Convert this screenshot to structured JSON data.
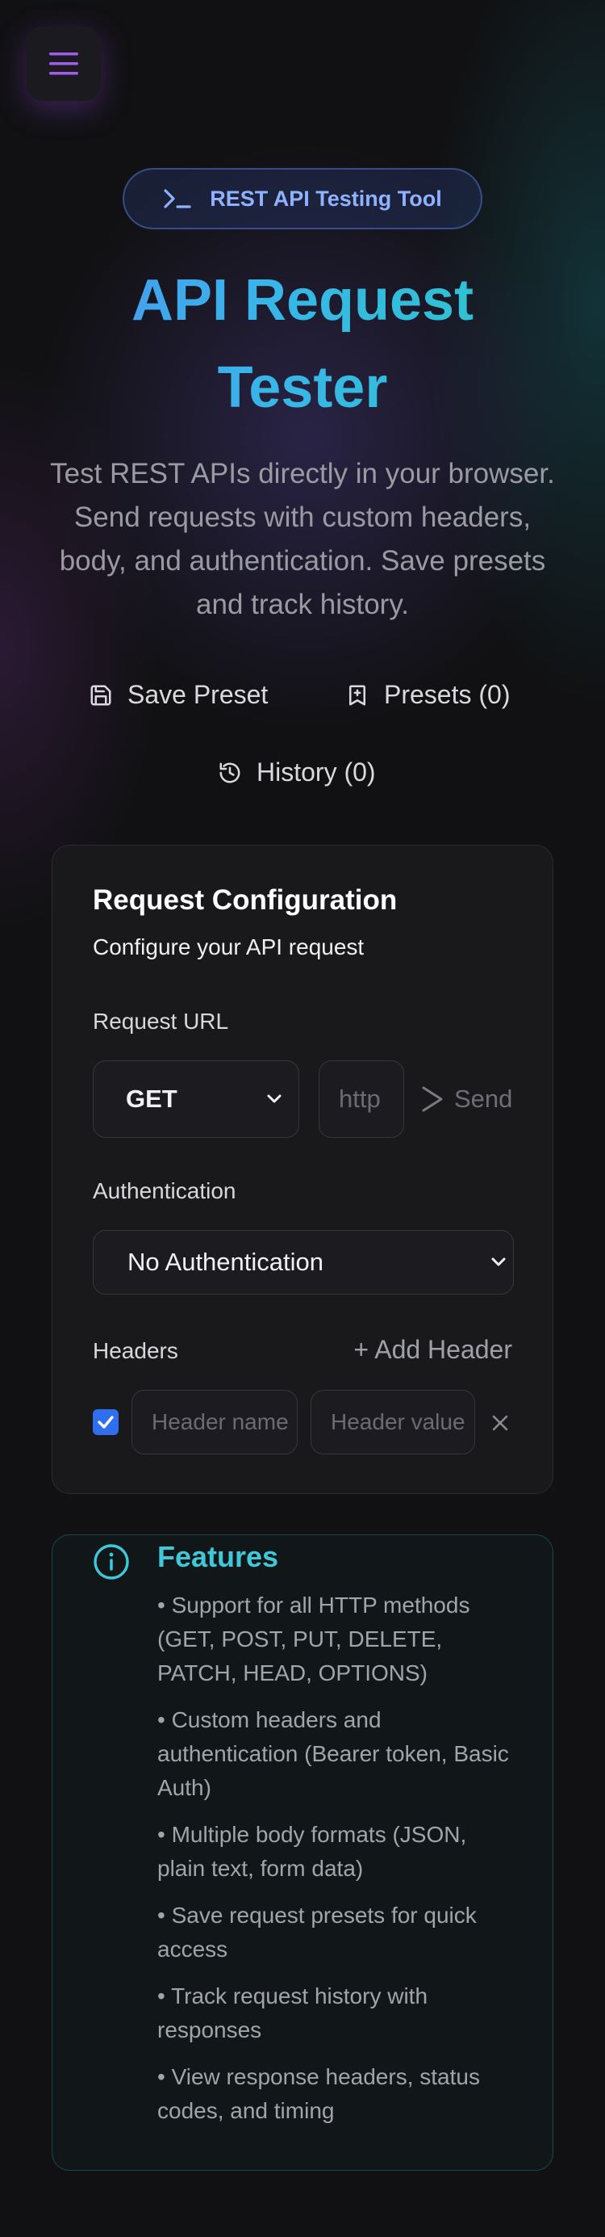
{
  "header": {
    "menu_icon": "hamburger-icon",
    "badge_icon": "terminal-icon",
    "badge_text": "REST API Testing Tool",
    "title_line1": "API Request",
    "title_line2": "Tester",
    "subtitle": "Test REST APIs directly in your browser. Send requests with custom headers, body, and authentication. Save presets and track history."
  },
  "actions": {
    "save_preset": "Save Preset",
    "presets": "Presets (0)",
    "history": "History (0)"
  },
  "request": {
    "title": "Request Configuration",
    "subtitle": "Configure your API request",
    "url_label": "Request URL",
    "method": "GET",
    "url_placeholder": "http",
    "send_label": "Send",
    "auth_label": "Authentication",
    "auth_value": "No Authentication",
    "headers_label": "Headers",
    "add_header": "+ Add Header",
    "header_name_placeholder": "Header name",
    "header_value_placeholder": "Header value",
    "header_enabled": true
  },
  "features": {
    "icon": "info-icon",
    "title": "Features",
    "items": [
      "• Support for all HTTP methods (GET, POST, PUT, DELETE, PATCH, HEAD, OPTIONS)",
      "• Custom headers and authentication (Bearer token, Basic Auth)",
      "• Multiple body formats (JSON, plain text, form data)",
      "• Save request presets for quick access",
      "• Track request history with responses",
      "• View response headers, status codes, and timing"
    ]
  },
  "colors": {
    "accent_purple": "#a45cf0",
    "accent_blue": "#8fb1ff",
    "accent_teal": "#3fc8d8",
    "checkbox_blue": "#2f6fed"
  }
}
